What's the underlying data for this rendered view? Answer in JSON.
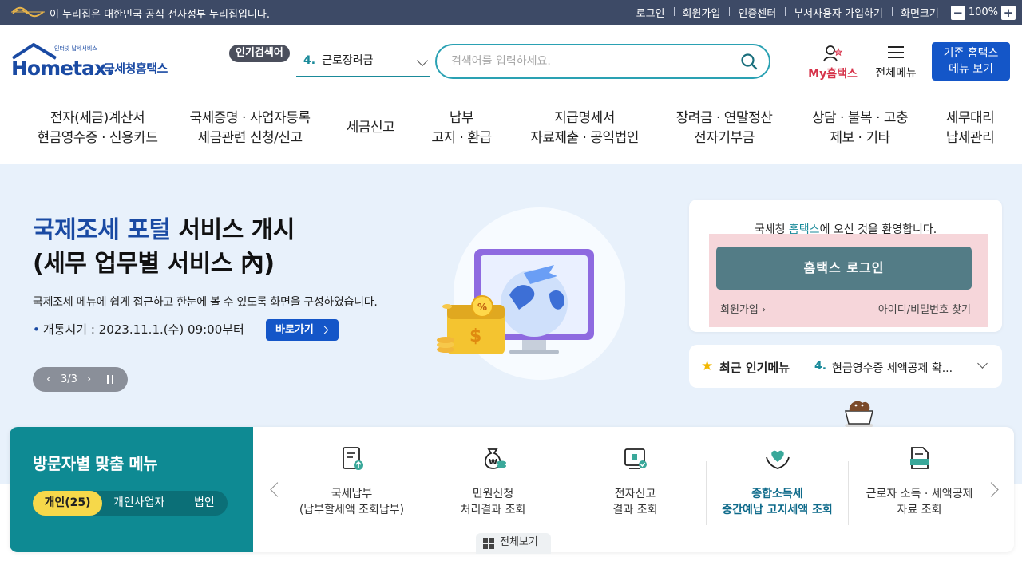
{
  "govbar": {
    "text": "이 누리집은 대한민국 공식 전자정부 누리집입니다.",
    "links": [
      "로그인",
      "회원가입",
      "인증센터",
      "부서사용자 가입하기",
      "화면크기"
    ],
    "zoom": "100%",
    "zoom_minus": "−",
    "zoom_plus": "+"
  },
  "logo": {
    "tagline": "인터넷 납세서비스",
    "word": "Hometax.",
    "name": "국세청홈택스"
  },
  "popular": {
    "badge": "인기검색어",
    "number": "4.",
    "term": "근로장려금"
  },
  "search": {
    "placeholder": "검색어를 입력하세요."
  },
  "header": {
    "mytax": "My홈택스",
    "allmenu": "전체메뉴",
    "old_line1": "기존 홈택스",
    "old_line2": "메뉴 보기"
  },
  "gnb": [
    {
      "l1": "전자(세금)계산서",
      "l2": "현금영수증 · 신용카드"
    },
    {
      "l1": "국세증명 · 사업자등록",
      "l2": "세금관련 신청/신고"
    },
    {
      "l1": "세금신고",
      "l2": ""
    },
    {
      "l1": "납부",
      "l2": "고지 · 환급"
    },
    {
      "l1": "지급명세서",
      "l2": "자료제출 · 공익법인"
    },
    {
      "l1": "장려금 · 연말정산",
      "l2": "전자기부금"
    },
    {
      "l1": "상담 · 불복 · 고충",
      "l2": "제보 · 기타"
    },
    {
      "l1": "세무대리",
      "l2": "납세관리"
    }
  ],
  "hero": {
    "title_blue": "국제조세 포털",
    "title_rest": " 서비스 개시",
    "title_line2": "(세무 업무별 서비스 內)",
    "desc": "국제조세 메뉴에 쉽게 접근하고 한눈에 볼 수 있도록 화면을 구성하였습니다.",
    "date": "개통시기 : 2023.11.1.(수) 09:00부터",
    "go": "바로가기",
    "pager": "3/3"
  },
  "login": {
    "welcome_pre": "국세청 ",
    "welcome_hl": "홈택스",
    "welcome_post": "에 오신 것을 환영합니다.",
    "button": "홈택스 로그인",
    "join": "회원가입",
    "find": "아이디/비밀번호 찾기"
  },
  "recent": {
    "title": "최근 인기메뉴",
    "number": "4.",
    "value": "현금영수증 세액공제 확..."
  },
  "visitor": {
    "title": "방문자별 맞춤 메뉴",
    "tabs": [
      "개인(25)",
      "개인사업자",
      "법인"
    ],
    "items": [
      {
        "l1": "국세납부",
        "l2": "(납부할세액 조회납부)",
        "icon": "tax-payment-icon"
      },
      {
        "l1": "민원신청",
        "l2": "처리결과 조회",
        "icon": "money-bag-icon"
      },
      {
        "l1": "전자신고",
        "l2": "결과 조회",
        "icon": "e-filing-icon"
      },
      {
        "l1": "종합소득세",
        "l2": "중간예납 고지세액 조회",
        "icon": "heart-hands-icon"
      },
      {
        "l1": "근로자 소득 · 세액공제",
        "l2": "자료 조회",
        "icon": "document-icon"
      }
    ],
    "view_all": "전체보기"
  },
  "colors": {
    "brand": "#1a4aa3",
    "teal": "#0e8a93",
    "button_blue": "#1456c8",
    "highlight": "#f6d84a"
  }
}
